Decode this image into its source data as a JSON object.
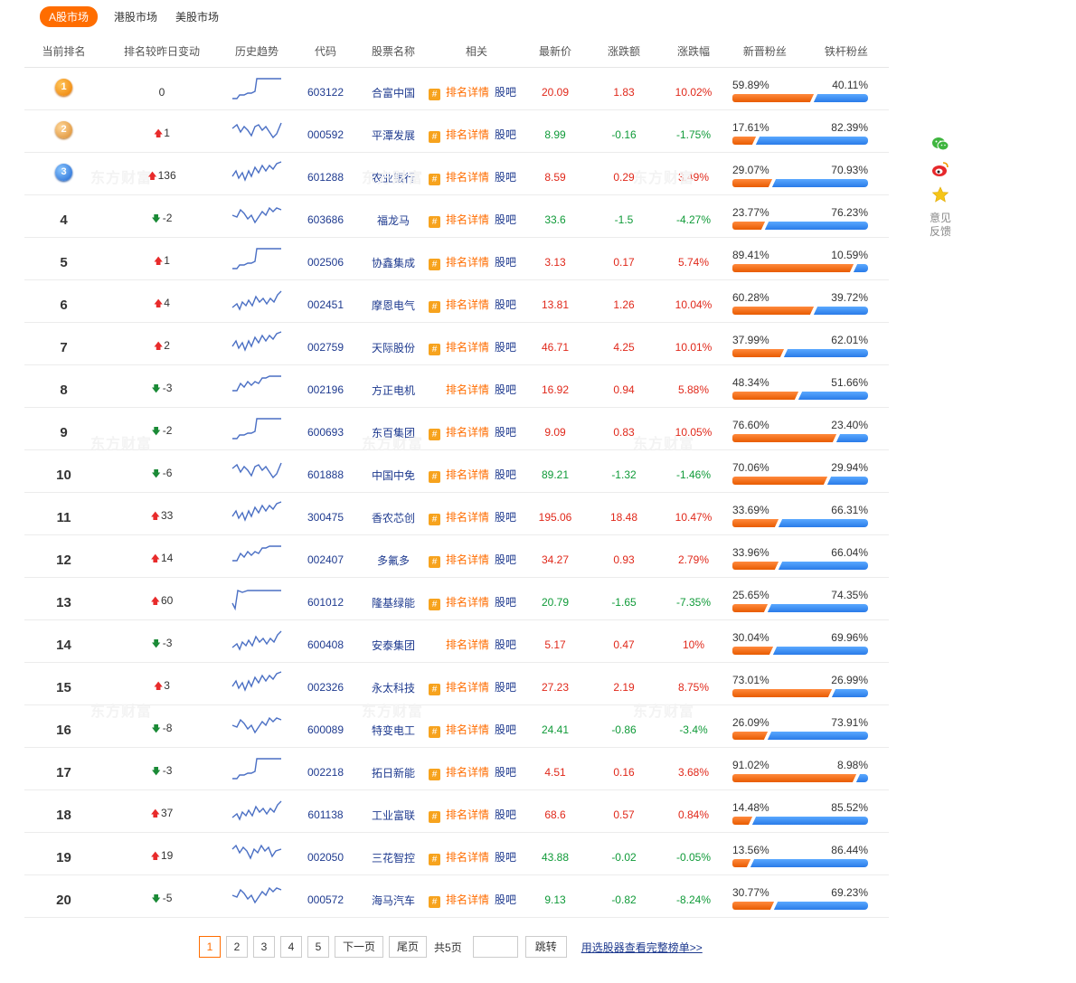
{
  "tabs": [
    {
      "label": "A股市场",
      "active": true
    },
    {
      "label": "港股市场",
      "active": false
    },
    {
      "label": "美股市场",
      "active": false
    }
  ],
  "headers": {
    "rank": "当前排名",
    "change": "排名较昨日变动",
    "trend": "历史趋势",
    "code": "代码",
    "name": "股票名称",
    "related": "相关",
    "price": "最新价",
    "amount": "涨跌额",
    "pct": "涨跌幅",
    "new_fans": "新晋粉丝",
    "old_fans": "铁杆粉丝"
  },
  "related_labels": {
    "icon": "#",
    "detail": "排名详情",
    "bar": "股吧"
  },
  "rows": [
    {
      "rank": "1",
      "medal": "g",
      "dir": "",
      "change": "0",
      "code": "603122",
      "name": "合富中国",
      "badge": true,
      "price": "20.09",
      "amount": "1.83",
      "pct": "10.02%",
      "trend_dir": "up",
      "new_pct": "59.89%",
      "new_val": 59.89,
      "old_pct": "40.11%"
    },
    {
      "rank": "2",
      "medal": "s",
      "dir": "up",
      "change": "1",
      "code": "000592",
      "name": "平潭发展",
      "badge": true,
      "price": "8.99",
      "amount": "-0.16",
      "pct": "-1.75%",
      "trend_dir": "dn",
      "new_pct": "17.61%",
      "new_val": 17.61,
      "old_pct": "82.39%"
    },
    {
      "rank": "3",
      "medal": "b",
      "dir": "up",
      "change": "136",
      "code": "601288",
      "name": "农业银行",
      "badge": true,
      "price": "8.59",
      "amount": "0.29",
      "pct": "3.49%",
      "trend_dir": "up",
      "new_pct": "29.07%",
      "new_val": 29.07,
      "old_pct": "70.93%"
    },
    {
      "rank": "4",
      "medal": "",
      "dir": "dn",
      "change": "-2",
      "code": "603686",
      "name": "福龙马",
      "badge": true,
      "price": "33.6",
      "amount": "-1.5",
      "pct": "-4.27%",
      "trend_dir": "dn",
      "new_pct": "23.77%",
      "new_val": 23.77,
      "old_pct": "76.23%"
    },
    {
      "rank": "5",
      "medal": "",
      "dir": "up",
      "change": "1",
      "code": "002506",
      "name": "协鑫集成",
      "badge": true,
      "price": "3.13",
      "amount": "0.17",
      "pct": "5.74%",
      "trend_dir": "up",
      "new_pct": "89.41%",
      "new_val": 89.41,
      "old_pct": "10.59%"
    },
    {
      "rank": "6",
      "medal": "",
      "dir": "up",
      "change": "4",
      "code": "002451",
      "name": "摩恩电气",
      "badge": true,
      "price": "13.81",
      "amount": "1.26",
      "pct": "10.04%",
      "trend_dir": "up",
      "new_pct": "60.28%",
      "new_val": 60.28,
      "old_pct": "39.72%"
    },
    {
      "rank": "7",
      "medal": "",
      "dir": "up",
      "change": "2",
      "code": "002759",
      "name": "天际股份",
      "badge": true,
      "price": "46.71",
      "amount": "4.25",
      "pct": "10.01%",
      "trend_dir": "up",
      "new_pct": "37.99%",
      "new_val": 37.99,
      "old_pct": "62.01%"
    },
    {
      "rank": "8",
      "medal": "",
      "dir": "dn",
      "change": "-3",
      "code": "002196",
      "name": "方正电机",
      "badge": false,
      "price": "16.92",
      "amount": "0.94",
      "pct": "5.88%",
      "trend_dir": "up",
      "new_pct": "48.34%",
      "new_val": 48.34,
      "old_pct": "51.66%"
    },
    {
      "rank": "9",
      "medal": "",
      "dir": "dn",
      "change": "-2",
      "code": "600693",
      "name": "东百集团",
      "badge": true,
      "price": "9.09",
      "amount": "0.83",
      "pct": "10.05%",
      "trend_dir": "up",
      "new_pct": "76.60%",
      "new_val": 76.6,
      "old_pct": "23.40%"
    },
    {
      "rank": "10",
      "medal": "",
      "dir": "dn",
      "change": "-6",
      "code": "601888",
      "name": "中国中免",
      "badge": true,
      "price": "89.21",
      "amount": "-1.32",
      "pct": "-1.46%",
      "trend_dir": "dn",
      "new_pct": "70.06%",
      "new_val": 70.06,
      "old_pct": "29.94%"
    },
    {
      "rank": "11",
      "medal": "",
      "dir": "up",
      "change": "33",
      "code": "300475",
      "name": "香农芯创",
      "badge": true,
      "price": "195.06",
      "amount": "18.48",
      "pct": "10.47%",
      "trend_dir": "up",
      "new_pct": "33.69%",
      "new_val": 33.69,
      "old_pct": "66.31%"
    },
    {
      "rank": "12",
      "medal": "",
      "dir": "up",
      "change": "14",
      "code": "002407",
      "name": "多氟多",
      "badge": true,
      "price": "34.27",
      "amount": "0.93",
      "pct": "2.79%",
      "trend_dir": "up",
      "new_pct": "33.96%",
      "new_val": 33.96,
      "old_pct": "66.04%"
    },
    {
      "rank": "13",
      "medal": "",
      "dir": "up",
      "change": "60",
      "code": "601012",
      "name": "隆基绿能",
      "badge": true,
      "price": "20.79",
      "amount": "-1.65",
      "pct": "-7.35%",
      "trend_dir": "dn",
      "new_pct": "25.65%",
      "new_val": 25.65,
      "old_pct": "74.35%"
    },
    {
      "rank": "14",
      "medal": "",
      "dir": "dn",
      "change": "-3",
      "code": "600408",
      "name": "安泰集团",
      "badge": false,
      "price": "5.17",
      "amount": "0.47",
      "pct": "10%",
      "trend_dir": "up",
      "new_pct": "30.04%",
      "new_val": 30.04,
      "old_pct": "69.96%"
    },
    {
      "rank": "15",
      "medal": "",
      "dir": "up",
      "change": "3",
      "code": "002326",
      "name": "永太科技",
      "badge": true,
      "price": "27.23",
      "amount": "2.19",
      "pct": "8.75%",
      "trend_dir": "up",
      "new_pct": "73.01%",
      "new_val": 73.01,
      "old_pct": "26.99%"
    },
    {
      "rank": "16",
      "medal": "",
      "dir": "dn",
      "change": "-8",
      "code": "600089",
      "name": "特变电工",
      "badge": true,
      "price": "24.41",
      "amount": "-0.86",
      "pct": "-3.4%",
      "trend_dir": "dn",
      "new_pct": "26.09%",
      "new_val": 26.09,
      "old_pct": "73.91%"
    },
    {
      "rank": "17",
      "medal": "",
      "dir": "dn",
      "change": "-3",
      "code": "002218",
      "name": "拓日新能",
      "badge": true,
      "price": "4.51",
      "amount": "0.16",
      "pct": "3.68%",
      "trend_dir": "up",
      "new_pct": "91.02%",
      "new_val": 91.02,
      "old_pct": "8.98%"
    },
    {
      "rank": "18",
      "medal": "",
      "dir": "up",
      "change": "37",
      "code": "601138",
      "name": "工业富联",
      "badge": true,
      "price": "68.6",
      "amount": "0.57",
      "pct": "0.84%",
      "trend_dir": "up",
      "new_pct": "14.48%",
      "new_val": 14.48,
      "old_pct": "85.52%"
    },
    {
      "rank": "19",
      "medal": "",
      "dir": "up",
      "change": "19",
      "code": "002050",
      "name": "三花智控",
      "badge": true,
      "price": "43.88",
      "amount": "-0.02",
      "pct": "-0.05%",
      "trend_dir": "dn",
      "new_pct": "13.56%",
      "new_val": 13.56,
      "old_pct": "86.44%"
    },
    {
      "rank": "20",
      "medal": "",
      "dir": "dn",
      "change": "-5",
      "code": "000572",
      "name": "海马汽车",
      "badge": true,
      "price": "9.13",
      "amount": "-0.82",
      "pct": "-8.24%",
      "trend_dir": "dn",
      "new_pct": "30.77%",
      "new_val": 30.77,
      "old_pct": "69.23%"
    }
  ],
  "side": {
    "feedback": "意见反馈",
    "icons": [
      "wechat-icon",
      "weibo-icon",
      "favorite-star-icon"
    ]
  },
  "pager": {
    "pages": [
      "1",
      "2",
      "3",
      "4",
      "5"
    ],
    "active": "1",
    "next": "下一页",
    "last": "尾页",
    "total": "共5页",
    "go": "跳转",
    "link": "用选股器查看完整榜单>>"
  },
  "watermark": "东方财富",
  "colors": {
    "accent": "#ff6d00",
    "up": "#e0281a",
    "down": "#0f9a38",
    "link": "#1e3a8f",
    "fans_new": "#f06a10",
    "fans_old": "#3a8ef0"
  }
}
